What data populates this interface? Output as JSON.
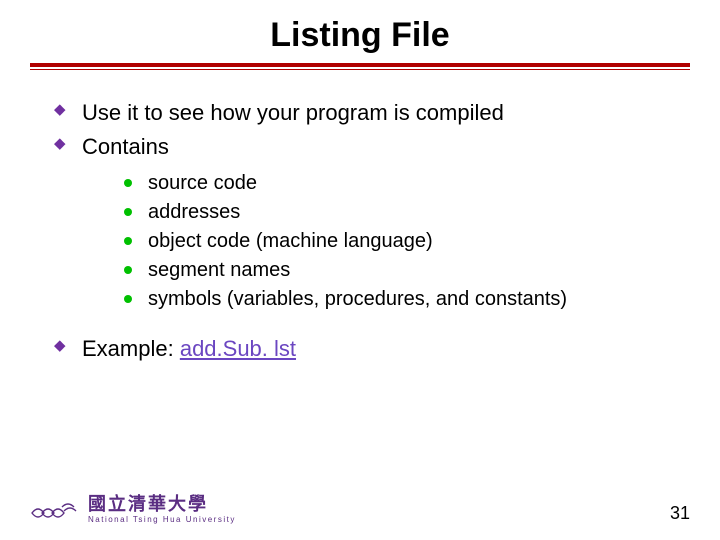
{
  "title": "Listing File",
  "bullets": {
    "b1": "Use it to see how your program is compiled",
    "b2": "Contains",
    "sub": {
      "s1": "source code",
      "s2": "addresses",
      "s3": "object code (machine language)",
      "s4": "segment names",
      "s5": "symbols (variables, procedures, and constants)"
    },
    "b3_prefix": "Example: ",
    "b3_link": "add.Sub. lst"
  },
  "footer": {
    "uni_cn": "國立清華大學",
    "uni_en": "National Tsing Hua University",
    "page": "31"
  }
}
